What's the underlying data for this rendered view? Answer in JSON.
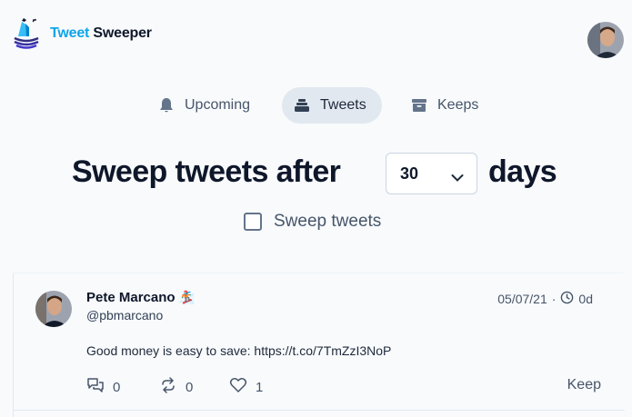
{
  "brand": {
    "part1": "Tweet",
    "part2": "Sweeper"
  },
  "nav": {
    "tabs": [
      {
        "label": "Upcoming",
        "icon": "bell-icon",
        "active": false
      },
      {
        "label": "Tweets",
        "icon": "stack-icon",
        "active": true
      },
      {
        "label": "Keeps",
        "icon": "archive-box-icon",
        "active": false
      }
    ]
  },
  "sweep": {
    "prefix": "Sweep tweets after",
    "days_value": "30",
    "suffix": "days",
    "checkbox_label": "Sweep tweets",
    "checked": false
  },
  "tweet": {
    "author": "Pete Marcano",
    "author_emoji": "🏂",
    "handle": "@pbmarcano",
    "date": "05/07/21",
    "separator": "·",
    "age": "0d",
    "text": "Good money is easy to save: https://t.co/7TmZzI3NoP",
    "replies": "0",
    "retweets": "0",
    "likes": "1",
    "keep_label": "Keep"
  },
  "colors": {
    "accent": "#0ea5e9",
    "text": "#0f172a",
    "muted": "#475569",
    "active_tab_bg": "#e2e8f0"
  }
}
